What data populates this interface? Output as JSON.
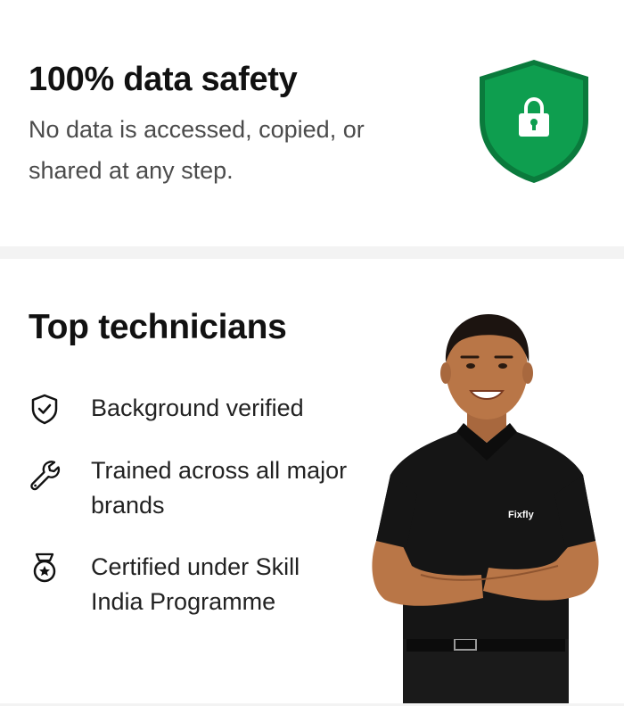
{
  "colors": {
    "shield": "#0e9e4f",
    "shield_border": "#0a7a3c",
    "text_primary": "#111111",
    "text_secondary": "#4b4b4b",
    "shirt": "#151515",
    "page_background": "#f3f3f3"
  },
  "safety": {
    "title": "100% data safety",
    "description": "No data is accessed, copied, or shared at any step.",
    "icon": "shield-lock-icon"
  },
  "technicians": {
    "title": "Top technicians",
    "features": [
      {
        "icon": "shield-check-icon",
        "label": "Background verified"
      },
      {
        "icon": "wrench-icon",
        "label": "Trained across all major brands"
      },
      {
        "icon": "medal-star-icon",
        "label": "Certified under Skill India Programme"
      }
    ],
    "photo": {
      "shirt_logo": "Fixfly"
    }
  }
}
